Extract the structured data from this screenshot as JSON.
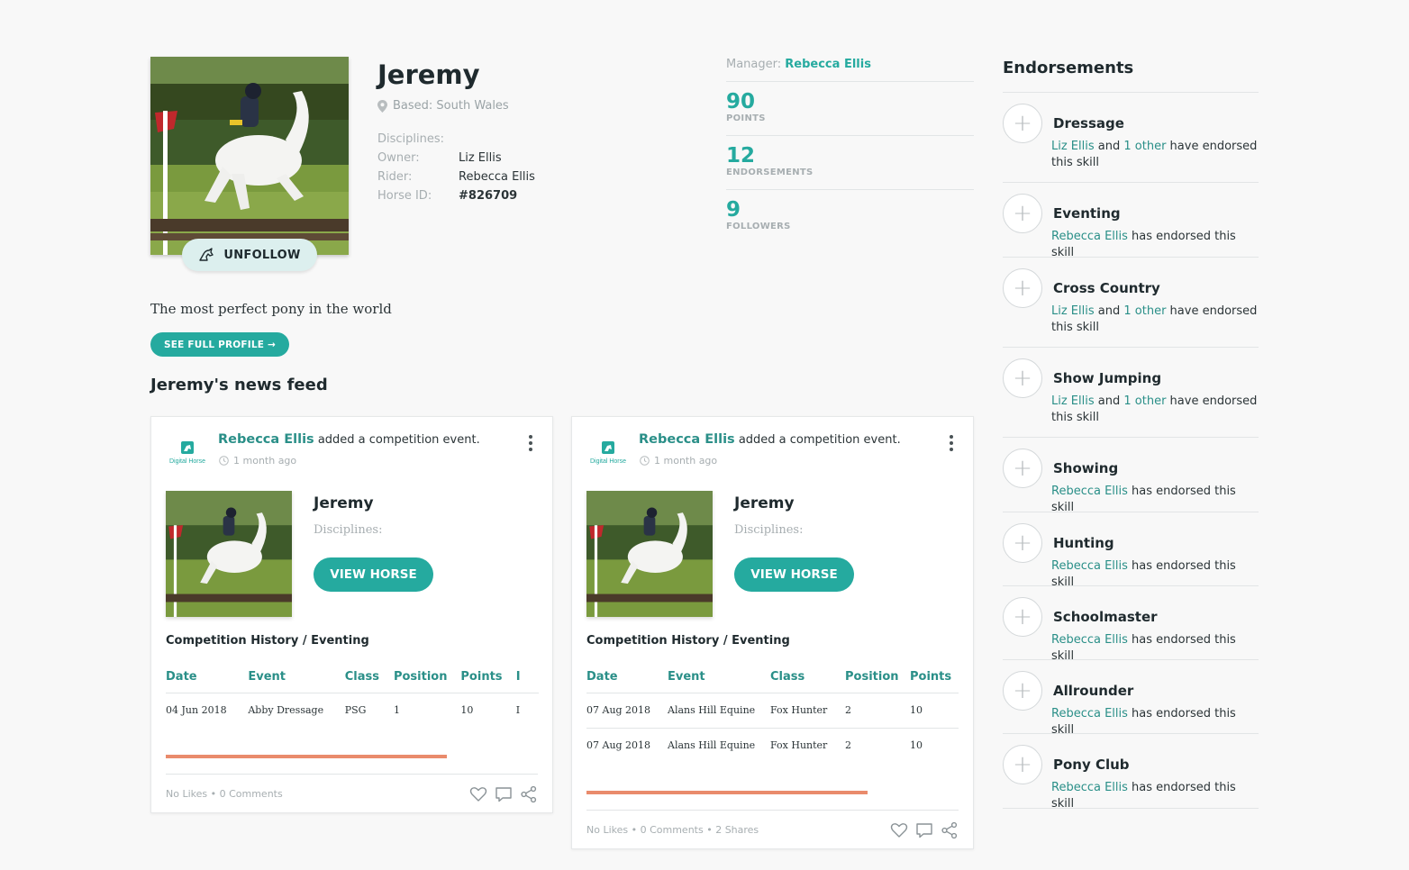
{
  "profile": {
    "name": "Jeremy",
    "based": "Based: South Wales",
    "disciplines_label": "Disciplines:",
    "owner_label": "Owner:",
    "owner": "Liz Ellis",
    "rider_label": "Rider:",
    "rider": "Rebecca Ellis",
    "horse_id_label": "Horse ID:",
    "horse_id": "#826709",
    "unfollow_label": "UNFOLLOW",
    "bio": "The most perfect pony in the world",
    "full_profile_label": "SEE FULL PROFILE →"
  },
  "stats": {
    "manager_label": "Manager:",
    "manager": "Rebecca Ellis",
    "items": [
      {
        "value": "90",
        "label": "POINTS"
      },
      {
        "value": "12",
        "label": "ENDORSEMENTS"
      },
      {
        "value": "9",
        "label": "FOLLOWERS"
      }
    ]
  },
  "feed": {
    "title": "Jeremy's news feed",
    "cards": [
      {
        "poster": "Rebecca Ellis",
        "action": "added a competition event.",
        "time": "1 month ago",
        "logo_text": "Digital Horse",
        "horse_name": "Jeremy",
        "disciplines": "Disciplines:",
        "view_label": "VIEW HORSE",
        "history_title": "Competition History / Eventing",
        "columns": [
          "Date",
          "Event",
          "Class",
          "Position",
          "Points",
          "I"
        ],
        "rows": [
          [
            "04 Jun 2018",
            "Abby Dressage",
            "PSG",
            "1",
            "10",
            "I"
          ]
        ],
        "stats": "No Likes • 0 Comments"
      },
      {
        "poster": "Rebecca Ellis",
        "action": "added a competition event.",
        "time": "1 month ago",
        "logo_text": "Digital Horse",
        "horse_name": "Jeremy",
        "disciplines": "Disciplines:",
        "view_label": "VIEW HORSE",
        "history_title": "Competition History / Eventing",
        "columns": [
          "Date",
          "Event",
          "Class",
          "Position",
          "Points"
        ],
        "rows": [
          [
            "07 Aug 2018",
            "Alans Hill Equine",
            "Fox Hunter",
            "2",
            "10"
          ],
          [
            "07 Aug 2018",
            "Alans Hill Equine",
            "Fox Hunter",
            "2",
            "10"
          ]
        ],
        "stats": "No Likes • 0 Comments • 2 Shares"
      }
    ]
  },
  "endorsements": {
    "title": "Endorsements",
    "skills": [
      {
        "name": "Dressage",
        "who": "Liz Ellis",
        "mid": " and ",
        "other": "1 other",
        "rest": " have endorsed this skill"
      },
      {
        "name": "Eventing",
        "who": "Rebecca Ellis",
        "mid": " has endorsed this skill",
        "other": "",
        "rest": ""
      },
      {
        "name": "Cross Country",
        "who": "Liz Ellis",
        "mid": " and ",
        "other": "1 other",
        "rest": " have endorsed this skill"
      },
      {
        "name": "Show Jumping",
        "who": "Liz Ellis",
        "mid": " and ",
        "other": "1 other",
        "rest": " have endorsed this skill"
      },
      {
        "name": "Showing",
        "who": "Rebecca Ellis",
        "mid": " has endorsed this skill",
        "other": "",
        "rest": ""
      },
      {
        "name": "Hunting",
        "who": "Rebecca Ellis",
        "mid": " has endorsed this skill",
        "other": "",
        "rest": ""
      },
      {
        "name": "Schoolmaster",
        "who": "Rebecca Ellis",
        "mid": " has endorsed this skill",
        "other": "",
        "rest": ""
      },
      {
        "name": "Allrounder",
        "who": "Rebecca Ellis",
        "mid": " has endorsed this skill",
        "other": "",
        "rest": ""
      },
      {
        "name": "Pony Club",
        "who": "Rebecca Ellis",
        "mid": " has endorsed this skill",
        "other": "",
        "rest": ""
      }
    ]
  },
  "colors": {
    "accent": "#25aa9f",
    "link": "#2a8f88",
    "progress": "#e98b6c",
    "follow_bg": "#dcefee"
  }
}
